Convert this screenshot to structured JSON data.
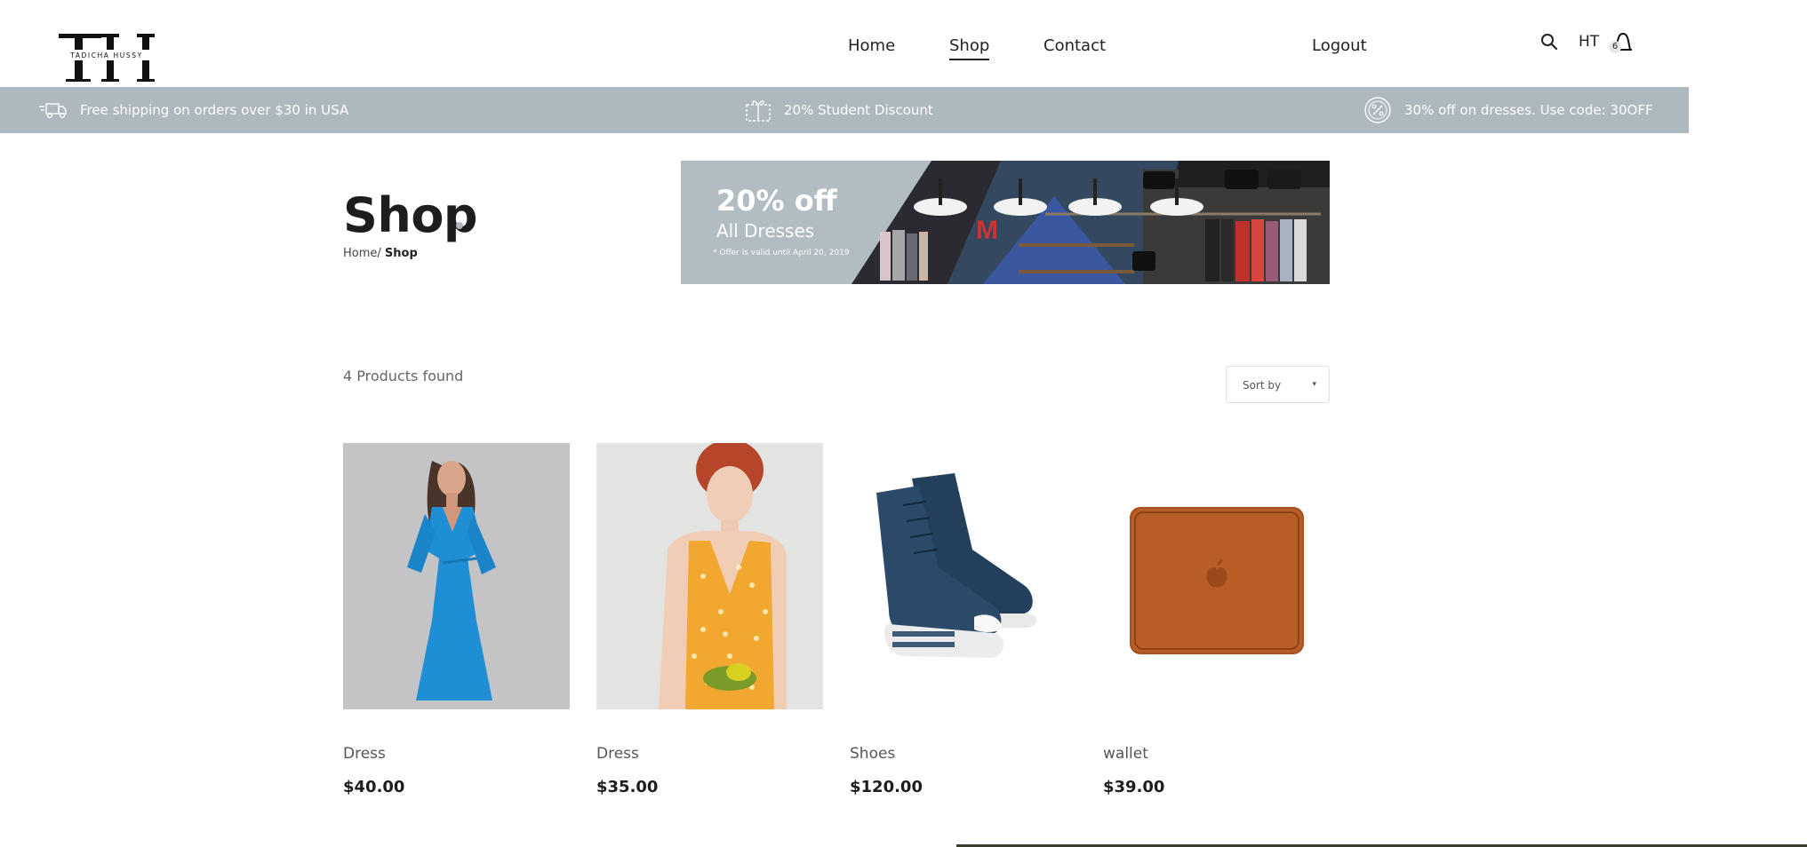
{
  "brand": {
    "logo_letters": "TH",
    "logo_text": "TADICHA HUSSY"
  },
  "nav": {
    "home": "Home",
    "shop": "Shop",
    "contact": "Contact",
    "logout": "Logout"
  },
  "header_right": {
    "search_icon": "search-icon",
    "user_initials": "HT",
    "cart_icon": "shopping-bag-icon",
    "cart_count": "6"
  },
  "promos": [
    {
      "icon": "delivery-truck-icon",
      "text": "Free shipping on orders over $30 in USA"
    },
    {
      "icon": "coupon-icon",
      "text": "20% Student Discount"
    },
    {
      "icon": "percent-badge-icon",
      "text": "30% off on dresses. Use code: 30OFF"
    }
  ],
  "page": {
    "title": "Shop",
    "breadcrumb": {
      "home": "Home/",
      "current": "Shop"
    }
  },
  "banner": {
    "headline": "20% off",
    "subline": "All Dresses",
    "note": "* Offer is valid until April 20, 2019"
  },
  "results": {
    "count_text": "4 Products found",
    "sort_label": "Sort by"
  },
  "products": [
    {
      "name": "Dress",
      "price": "$40.00"
    },
    {
      "name": "Dress",
      "price": "$35.00"
    },
    {
      "name": "Shoes",
      "price": "$120.00"
    },
    {
      "name": "wallet",
      "price": "$39.00"
    }
  ],
  "colors": {
    "promo_bar": "#aeb8bf",
    "text_dark": "#1d1d1d",
    "accent_dot": "#aeb8bf"
  }
}
